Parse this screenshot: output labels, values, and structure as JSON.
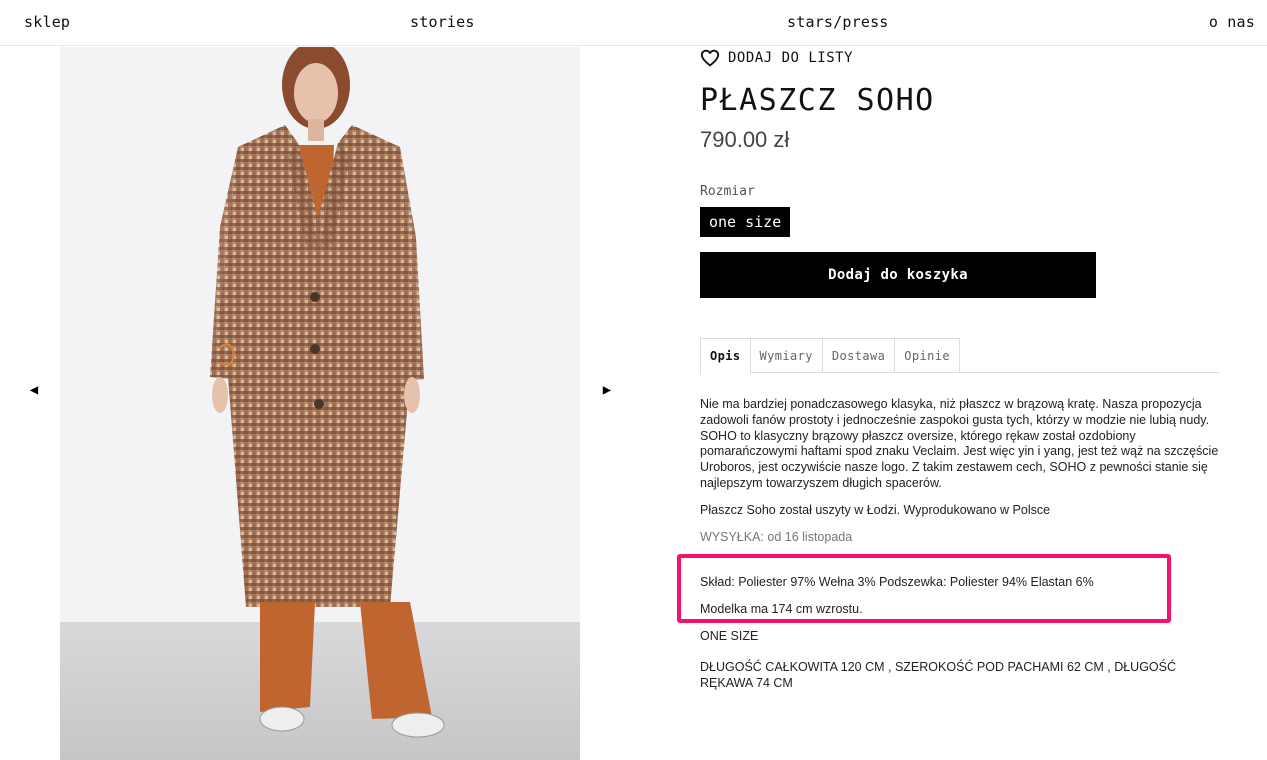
{
  "nav": {
    "items": [
      "sklep",
      "stories",
      "stars/press",
      "o nas"
    ]
  },
  "gallery": {
    "prev_icon": "triangle-left-icon",
    "next_icon": "triangle-right-icon",
    "image_alt": "model in brown houndstooth coat"
  },
  "product": {
    "wishlist_label": "DODAJ DO LISTY",
    "title": "PŁASZCZ SOHO",
    "price": "790.00 zł",
    "size_label": "Rozmiar",
    "size_option": "one size",
    "add_to_cart": "Dodaj do koszyka"
  },
  "tabs": [
    {
      "label": "Opis",
      "active": true
    },
    {
      "label": "Wymiary",
      "active": false
    },
    {
      "label": "Dostawa",
      "active": false
    },
    {
      "label": "Opinie",
      "active": false
    }
  ],
  "description": {
    "paragraph1": "Nie ma bardziej ponadczasowego klasyka, niż płaszcz w brązową kratę. Nasza propozycja zadowoli fanów prostoty i jednocześnie zaspokoi gusta tych, którzy w modzie nie lubią nudy. SOHO to klasyczny brązowy płaszcz oversize, którego rękaw został ozdobiony pomarańczowymi haftami spod znaku Veclaim. Jest więc yin i yang, jest też wąż na szczęście Uroboros, jest oczywiście nasze logo. Z takim zestawem cech, SOHO z pewności stanie się najlepszym towarzyszem długich spacerów.",
    "paragraph2": "Płaszcz Soho został uszyty w Łodzi. Wyprodukowano w Polsce",
    "shipping": "WYSYŁKA: od 16 listopada",
    "composition": "Skład: Poliester 97% Wełna 3% Podszewka: Poliester 94% Elastan 6%",
    "model": "Modelka ma 174 cm wzrostu.",
    "one_size": "ONE SIZE",
    "dimensions": "DŁUGOŚĆ CAŁKOWITA 120 CM , SZEROKOŚĆ POD PACHAMI 62 CM , DŁUGOŚĆ RĘKAWA 74 CM"
  },
  "colors": {
    "highlight": "#f4136b",
    "button": "#000000"
  }
}
